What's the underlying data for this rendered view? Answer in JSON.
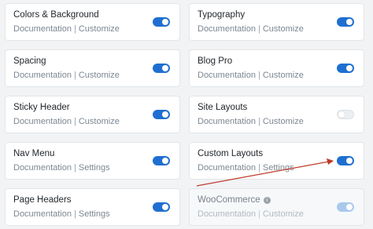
{
  "modules": [
    {
      "title": "Colors & Background",
      "link1": "Documentation",
      "separator": "|",
      "link2": "Customize",
      "enabled": true
    },
    {
      "title": "Typography",
      "link1": "Documentation",
      "separator": "|",
      "link2": "Customize",
      "enabled": true
    },
    {
      "title": "Spacing",
      "link1": "Documentation",
      "separator": "|",
      "link2": "Customize",
      "enabled": true
    },
    {
      "title": "Blog Pro",
      "link1": "Documentation",
      "separator": "|",
      "link2": "Customize",
      "enabled": true
    },
    {
      "title": "Sticky Header",
      "link1": "Documentation",
      "separator": "|",
      "link2": "Customize",
      "enabled": true
    },
    {
      "title": "Site Layouts",
      "link1": "Documentation",
      "separator": "|",
      "link2": "Customize",
      "enabled": false
    },
    {
      "title": "Nav Menu",
      "link1": "Documentation",
      "separator": "|",
      "link2": "Settings",
      "enabled": true
    },
    {
      "title": "Custom Layouts",
      "link1": "Documentation",
      "separator": "|",
      "link2": "Settings",
      "enabled": true
    },
    {
      "title": "Page Headers",
      "link1": "Documentation",
      "separator": "|",
      "link2": "Settings",
      "enabled": true
    },
    {
      "title": "WooCommerce",
      "link1": "Documentation",
      "separator": "|",
      "link2": "Customize",
      "enabled": true,
      "disabled": true,
      "info_icon": "info-icon"
    }
  ],
  "colors": {
    "toggle_on": "#1f6fd1",
    "toggle_off": "#eceff2",
    "annotation_arrow": "#c0392b"
  }
}
